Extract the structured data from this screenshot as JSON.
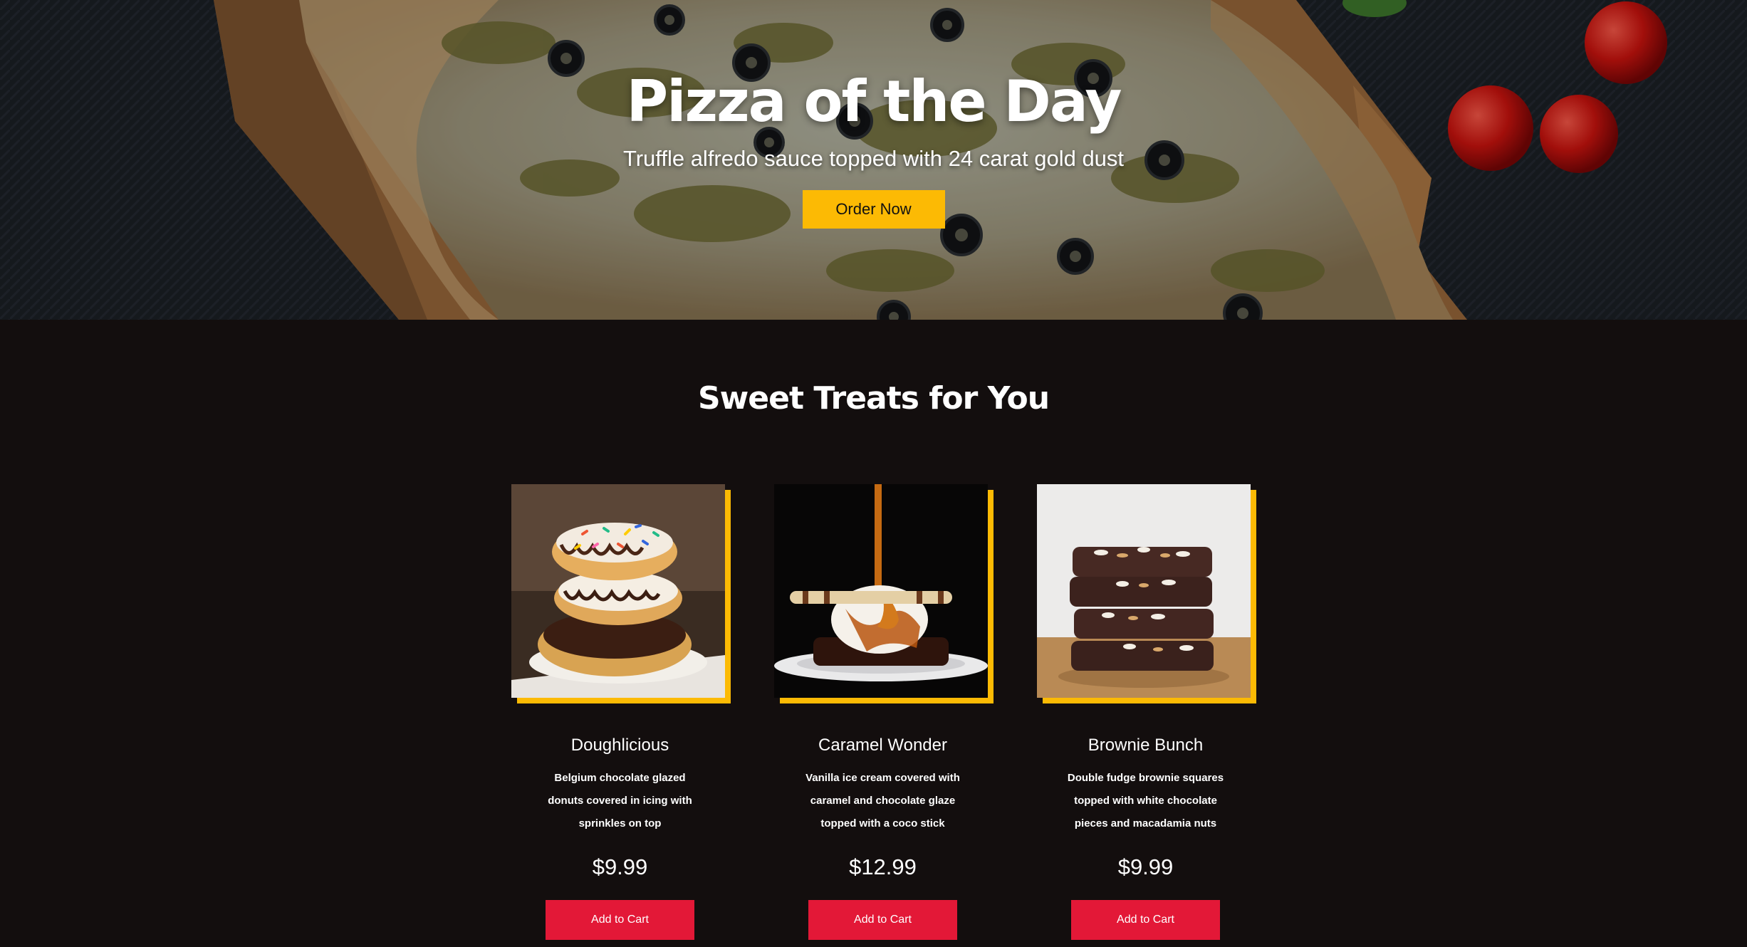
{
  "hero": {
    "title": "Pizza of the Day",
    "subtitle": "Truffle alfredo sauce topped with 24 carat gold dust",
    "cta_label": "Order Now"
  },
  "treats": {
    "heading": "Sweet Treats for You",
    "items": [
      {
        "name": "Doughlicious",
        "description": "Belgium chocolate glazed donuts covered in icing with sprinkles on top",
        "price": "$9.99",
        "button_label": "Add to Cart",
        "image": "donuts-photo"
      },
      {
        "name": "Caramel Wonder",
        "description": "Vanilla ice cream covered with caramel and chocolate glaze topped with a coco stick",
        "price": "$12.99",
        "button_label": "Add to Cart",
        "image": "ice-cream-photo"
      },
      {
        "name": "Brownie Bunch",
        "description": "Double fudge brownie squares topped with white chocolate pieces and macadamia nuts",
        "price": "$9.99",
        "button_label": "Add to Cart",
        "image": "brownies-photo"
      }
    ]
  },
  "colors": {
    "accent_yellow": "#fcba04",
    "button_red": "#e31837",
    "background": "#130e0e"
  }
}
